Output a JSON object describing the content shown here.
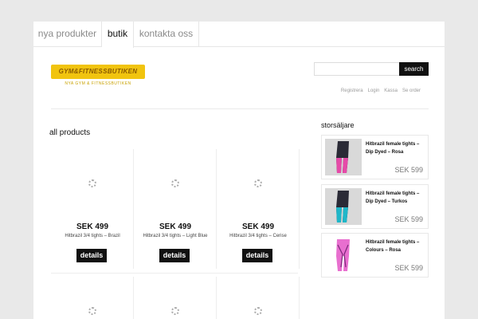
{
  "nav": {
    "items": [
      {
        "label": "nya produkter"
      },
      {
        "label": "butik"
      },
      {
        "label": "kontakta oss"
      }
    ]
  },
  "header": {
    "logo_text": "GYM&FITNESSBUTIKEN",
    "tagline": "NYA GYM & FITNESSBUTIKEN",
    "search_placeholder": "",
    "search_label": "search",
    "account_links": [
      "Registrera",
      "Login",
      "Kassa",
      "Se order"
    ]
  },
  "main": {
    "title": "all products",
    "products": [
      {
        "price": "SEK 499",
        "name": "Hitbrazil 3/4 tights – Brazil",
        "details_label": "details"
      },
      {
        "price": "SEK 499",
        "name": "Hitbrazil 3/4 tights – Light Blue",
        "details_label": "details"
      },
      {
        "price": "SEK 499",
        "name": "Hitbrazil 3/4 tights – Cerise",
        "details_label": "details"
      }
    ]
  },
  "sidebar": {
    "title": "storsäljare",
    "items": [
      {
        "title": "Hitbrazil female tights – Dip Dyed – Rosa",
        "price": "SEK 599",
        "accent": "#e64aa8"
      },
      {
        "title": "Hitbrazil female tights – Dip Dyed – Turkos",
        "price": "SEK 599",
        "accent": "#1fb7c9"
      },
      {
        "title": "Hitbrazil female tights – Colours – Rosa",
        "price": "SEK 599",
        "accent": "#e86fcf"
      }
    ]
  },
  "colors": {
    "background": "#e9e9e9",
    "button": "#111111",
    "logo": "#f1c40f"
  }
}
